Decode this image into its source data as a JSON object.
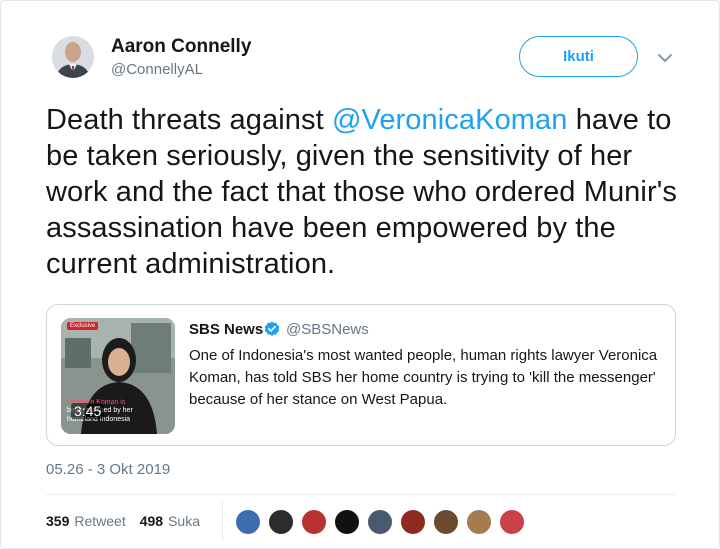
{
  "author": {
    "name": "Aaron Connelly",
    "handle": "@ConnellyAL"
  },
  "follow_button": {
    "label": "Ikuti"
  },
  "menu": {
    "icon": "chevron-down-icon"
  },
  "tweet": {
    "text_before": "Death threats against ",
    "mention": "@VeronicaKoman",
    "text_after": " have to be taken seriously, given the sensitivity of her work and the fact that those who ordered Munir's assassination have been empowered by the current administration."
  },
  "quote": {
    "name": "SBS News",
    "handle": "@SBSNews",
    "verified_icon": "verified-badge-icon",
    "text": "One of Indonesia's most wanted people, human rights lawyer Veronica Koman, has told SBS her home country is trying to 'kill the messenger' because of her stance on West Papua.",
    "thumbnail": {
      "badge": "Exclusive",
      "duration": "3:45",
      "caption_line1": "Veronica Koman is",
      "caption_line2": "being pursued by her",
      "caption_line3": "homeland Indonesia"
    }
  },
  "timestamp": "05.26 - 3 Okt 2019",
  "stats": {
    "retweets_count": "359",
    "retweets_label": "Retweet",
    "likes_count": "498",
    "likes_label": "Suka"
  },
  "likers": [
    {
      "name": "liker-1",
      "color": "#3d6fb0"
    },
    {
      "name": "liker-2",
      "color": "#2c2c2c"
    },
    {
      "name": "liker-3",
      "color": "#b8322f"
    },
    {
      "name": "liker-4",
      "color": "#111111"
    },
    {
      "name": "liker-5",
      "color": "#4a5a6e"
    },
    {
      "name": "liker-6",
      "color": "#8e2a1f"
    },
    {
      "name": "liker-7",
      "color": "#6b4a2e"
    },
    {
      "name": "liker-8",
      "color": "#a57c4e"
    },
    {
      "name": "liker-9",
      "color": "#c9424a"
    }
  ],
  "colors": {
    "accent": "#1da1f2",
    "text_primary": "#14171a",
    "text_secondary": "#657786",
    "border": "#ccd6dd"
  }
}
